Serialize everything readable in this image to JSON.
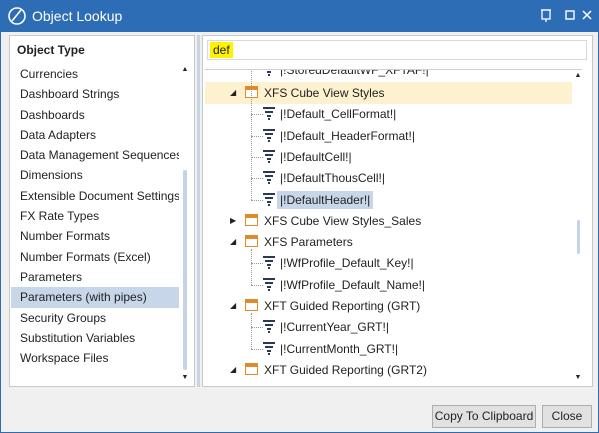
{
  "window": {
    "title": "Object Lookup",
    "colors": {
      "titlebar": "#2d6db5",
      "selection": "#c8d6ea",
      "group_highlight": "#fef1cf",
      "search_highlight": "#fff200"
    }
  },
  "left": {
    "header": "Object Type",
    "items": [
      "Currencies",
      "Dashboard Strings",
      "Dashboards",
      "Data Adapters",
      "Data Management Sequences",
      "Dimensions",
      "Extensible Document Settings",
      "FX Rate Types",
      "Number Formats",
      "Number Formats (Excel)",
      "Parameters",
      "Parameters (with pipes)",
      "Security Groups",
      "Substitution Variables",
      "Workspace Files"
    ],
    "selected": "Parameters (with pipes)"
  },
  "search": {
    "value": "def"
  },
  "tree": {
    "partial_top": "|!StoredDefaultWF_XFTAF!|",
    "rows": [
      {
        "label": "XFS Cube View Styles",
        "type": "group",
        "expanded": true
      },
      {
        "label": "|!Default_CellFormat!|",
        "type": "item"
      },
      {
        "label": "|!Default_HeaderFormat!|",
        "type": "item"
      },
      {
        "label": "|!DefaultCell!|",
        "type": "item"
      },
      {
        "label": "|!DefaultThousCell!|",
        "type": "item"
      },
      {
        "label": "|!DefaultHeader!|",
        "type": "item",
        "selected": true
      },
      {
        "label": "XFS Cube View Styles_Sales",
        "type": "group",
        "expanded": false
      },
      {
        "label": "XFS Parameters",
        "type": "group",
        "expanded": true
      },
      {
        "label": "|!WfProfile_Default_Key!|",
        "type": "item"
      },
      {
        "label": "|!WfProfile_Default_Name!|",
        "type": "item"
      },
      {
        "label": "XFT Guided Reporting (GRT)",
        "type": "group",
        "expanded": true
      },
      {
        "label": "|!CurrentYear_GRT!|",
        "type": "item"
      },
      {
        "label": "|!CurrentMonth_GRT!|",
        "type": "item"
      },
      {
        "label": "XFT Guided Reporting (GRT2)",
        "type": "group",
        "expanded": true
      }
    ]
  },
  "buttons": {
    "copy": "Copy To Clipboard",
    "close": "Close"
  }
}
